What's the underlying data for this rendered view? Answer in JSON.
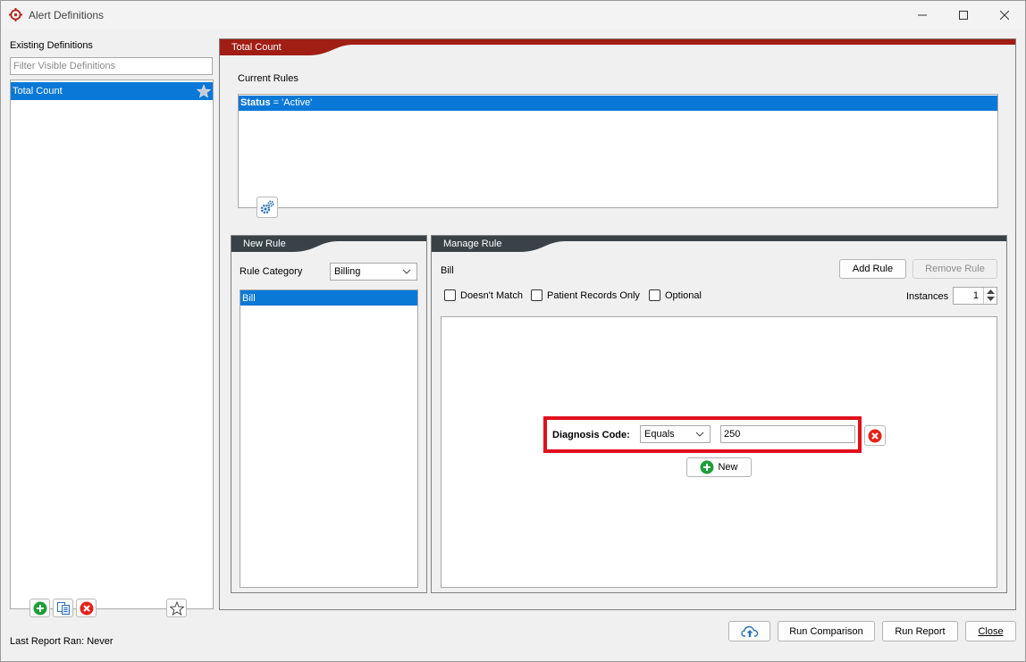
{
  "window": {
    "title": "Alert Definitions"
  },
  "left": {
    "heading": "Existing Definitions",
    "filter_placeholder": "Filter Visible Definitions",
    "items": [
      {
        "label": "Total Count",
        "selected": true
      }
    ],
    "last_report": "Last Report Ran: Never"
  },
  "definition": {
    "tab_label": "Total Count",
    "current_rules_label": "Current Rules",
    "rules": [
      {
        "field": "Status",
        "expr": " = 'Active'"
      }
    ]
  },
  "new_rule": {
    "tab_label": "New Rule",
    "category_label": "Rule Category",
    "category_value": "Billing",
    "items": [
      {
        "label": "Bill",
        "selected": true
      }
    ]
  },
  "manage_rule": {
    "tab_label": "Manage Rule",
    "rule_name": "Bill",
    "add_rule": "Add Rule",
    "remove_rule": "Remove Rule",
    "doesnt_match": "Doesn't Match",
    "patient_records_only": "Patient Records Only",
    "optional": "Optional",
    "instances_label": "Instances",
    "instances_value": "1",
    "criterion": {
      "label": "Diagnosis Code:",
      "operator": "Equals",
      "value": "250"
    },
    "new_button": "New"
  },
  "footer": {
    "run_comparison": "Run Comparison",
    "run_report": "Run Report",
    "close": "Close"
  },
  "colors": {
    "tab_dark_red": "#a01e14",
    "tab_dark_gray": "#3a4248",
    "selection_blue": "#0a78d7",
    "highlight_red": "#e0101a",
    "add_green": "#1e9e3a",
    "delete_red": "#e2231a"
  }
}
